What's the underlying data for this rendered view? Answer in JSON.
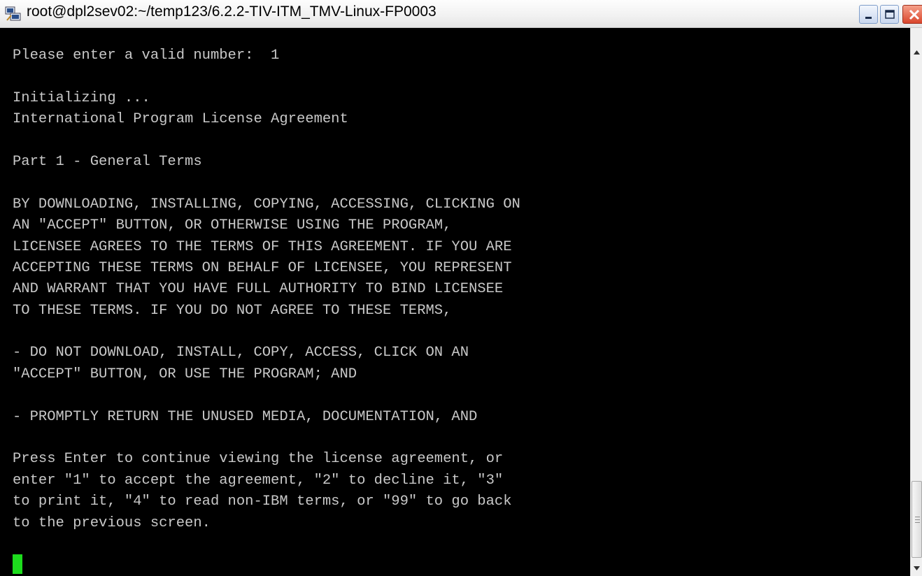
{
  "window": {
    "title": "root@dpl2sev02:~/temp123/6.2.2-TIV-ITM_TMV-Linux-FP0003",
    "icons": {
      "app": "putty-icon",
      "minimize": "minimize-icon",
      "maximize": "maximize-icon",
      "close": "close-icon"
    }
  },
  "terminal": {
    "lines": [
      "Please enter a valid number:  1",
      "",
      "Initializing ...",
      "International Program License Agreement",
      "",
      "Part 1 - General Terms",
      "",
      "BY DOWNLOADING, INSTALLING, COPYING, ACCESSING, CLICKING ON",
      "AN \"ACCEPT\" BUTTON, OR OTHERWISE USING THE PROGRAM,",
      "LICENSEE AGREES TO THE TERMS OF THIS AGREEMENT. IF YOU ARE",
      "ACCEPTING THESE TERMS ON BEHALF OF LICENSEE, YOU REPRESENT",
      "AND WARRANT THAT YOU HAVE FULL AUTHORITY TO BIND LICENSEE",
      "TO THESE TERMS. IF YOU DO NOT AGREE TO THESE TERMS,",
      "",
      "- DO NOT DOWNLOAD, INSTALL, COPY, ACCESS, CLICK ON AN",
      "\"ACCEPT\" BUTTON, OR USE THE PROGRAM; AND",
      "",
      "- PROMPTLY RETURN THE UNUSED MEDIA, DOCUMENTATION, AND",
      "",
      "Press Enter to continue viewing the license agreement, or",
      "enter \"1\" to accept the agreement, \"2\" to decline it, \"3\"",
      "to print it, \"4\" to read non-IBM terms, or \"99\" to go back",
      "to the previous screen."
    ],
    "cursor_color": "#1ddc1d",
    "text_color": "#c8c8c8",
    "background_color": "#000000"
  }
}
